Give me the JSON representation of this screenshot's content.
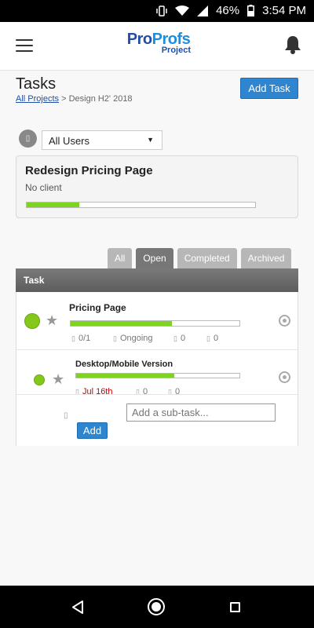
{
  "status_bar": {
    "battery": "46%",
    "time": "3:54 PM"
  },
  "header": {
    "logo_pro": "Pro",
    "logo_profs": "Profs",
    "logo_sub": "Project"
  },
  "page": {
    "title": "Tasks",
    "breadcrumb_link": "All Projects",
    "breadcrumb_rest": " > Design H2' 2018",
    "add_task_label": "Add Task"
  },
  "filter": {
    "selected": "All Users"
  },
  "project": {
    "name": "Redesign Pricing Page",
    "client": "No client",
    "progress": 0.23
  },
  "tabs": [
    {
      "label": "All",
      "active": false
    },
    {
      "label": "Open",
      "active": true
    },
    {
      "label": "Completed",
      "active": false
    },
    {
      "label": "Archived",
      "active": false
    }
  ],
  "table": {
    "header": "Task"
  },
  "tasks": [
    {
      "name": "Pricing Page",
      "progress": 0.6,
      "subtasks": "0/1",
      "status": "Ongoing",
      "comments": "0",
      "attachments": "0"
    },
    {
      "name": "Desktop/Mobile Version",
      "progress": 0.6,
      "due": "Jul 16th",
      "comments": "0",
      "attachments": "0"
    }
  ],
  "subtask": {
    "placeholder": "Add a sub-task...",
    "add_label": "Add"
  },
  "colors": {
    "accent": "#2f86d0",
    "progress": "#7ed321",
    "status_dot": "#84c91a",
    "due_overdue": "#cc0000"
  },
  "icons": [
    "hamburger-menu-icon",
    "bell-icon",
    "user-icon",
    "star-icon",
    "gear-icon",
    "subtask-icon",
    "back-icon",
    "home-icon",
    "recents-icon"
  ]
}
